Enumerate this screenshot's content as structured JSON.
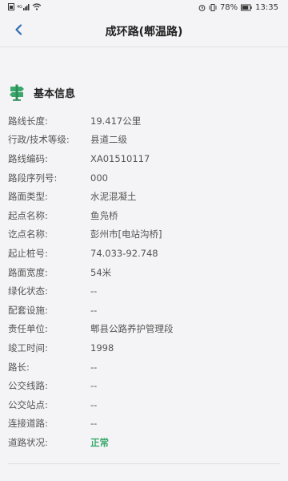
{
  "status_bar": {
    "left_icons": [
      "sim-card-icon",
      "signal-icon",
      "wifi-icon"
    ],
    "right_icons": [
      "alarm-icon",
      "vibrate-icon"
    ],
    "battery": "78%",
    "time": "13:35"
  },
  "header": {
    "title": "成环路(郫温路)"
  },
  "section": {
    "icon": "signpost-icon",
    "title": "基本信息",
    "accent_color": "#3aa86b"
  },
  "rows": [
    {
      "label": "路线长度:",
      "value": "19.417公里"
    },
    {
      "label": "行政/技术等级:",
      "value": "县道二级"
    },
    {
      "label": "路线编码:",
      "value": "XA01510117"
    },
    {
      "label": "路段序列号:",
      "value": "000"
    },
    {
      "label": "路面类型:",
      "value": "水泥混凝土"
    },
    {
      "label": "起点名称:",
      "value": "鱼凫桥"
    },
    {
      "label": "讫点名称:",
      "value": "彭州市[电站沟桥]"
    },
    {
      "label": "起止桩号:",
      "value": "74.033-92.748"
    },
    {
      "label": "路面宽度:",
      "value": "54米"
    },
    {
      "label": "绿化状态:",
      "value": "--"
    },
    {
      "label": "配套设施:",
      "value": "--"
    },
    {
      "label": "责任单位:",
      "value": "郫县公路养护管理段"
    },
    {
      "label": "竣工时间:",
      "value": "1998"
    },
    {
      "label": "路长:",
      "value": "--"
    },
    {
      "label": "公交线路:",
      "value": "--"
    },
    {
      "label": "公交站点:",
      "value": "--"
    },
    {
      "label": "连接道路:",
      "value": "--"
    },
    {
      "label": "道路状况:",
      "value": "正常"
    }
  ]
}
